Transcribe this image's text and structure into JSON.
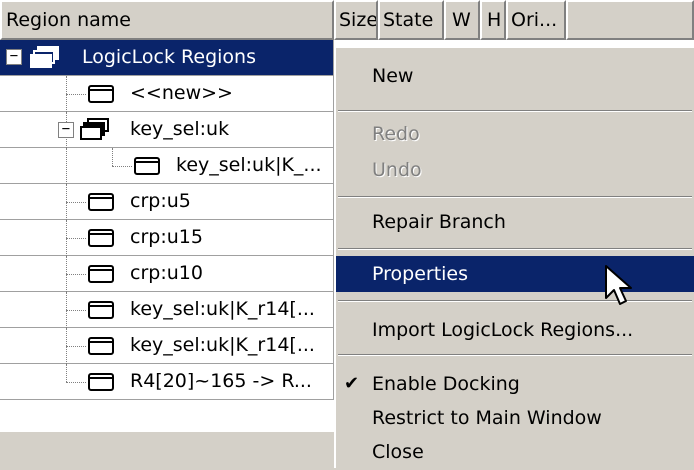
{
  "columns": [
    {
      "label": "Region name"
    },
    {
      "label": "Size"
    },
    {
      "label": "State"
    },
    {
      "label": "W"
    },
    {
      "label": "H"
    },
    {
      "label": "Ori..."
    }
  ],
  "tree": [
    {
      "label": "LogicLock Regions",
      "selected": true,
      "icon": "regions-folder-icon"
    },
    {
      "label": "<<new>>",
      "icon": "region-icon"
    },
    {
      "label": "key_sel:uk",
      "icon": "regions-folder-icon"
    },
    {
      "label": "key_sel:uk|K_...",
      "icon": "region-icon"
    },
    {
      "label": "crp:u5",
      "icon": "region-icon"
    },
    {
      "label": "crp:u15",
      "icon": "region-icon"
    },
    {
      "label": "crp:u10",
      "icon": "region-icon"
    },
    {
      "label": "key_sel:uk|K_r14[...",
      "icon": "region-icon"
    },
    {
      "label": "key_sel:uk|K_r14[...",
      "icon": "region-icon"
    },
    {
      "label": "R4[20]~165 -> R...",
      "icon": "region-icon"
    }
  ],
  "menu": {
    "new": "New",
    "redo": "Redo",
    "undo": "Undo",
    "repair_branch": "Repair Branch",
    "properties": "Properties",
    "import": "Import LogicLock Regions...",
    "enable_docking": "Enable Docking",
    "restrict": "Restrict to Main Window",
    "close": "Close"
  },
  "colors": {
    "selection": "#0a246a",
    "face": "#d4d0c8"
  }
}
